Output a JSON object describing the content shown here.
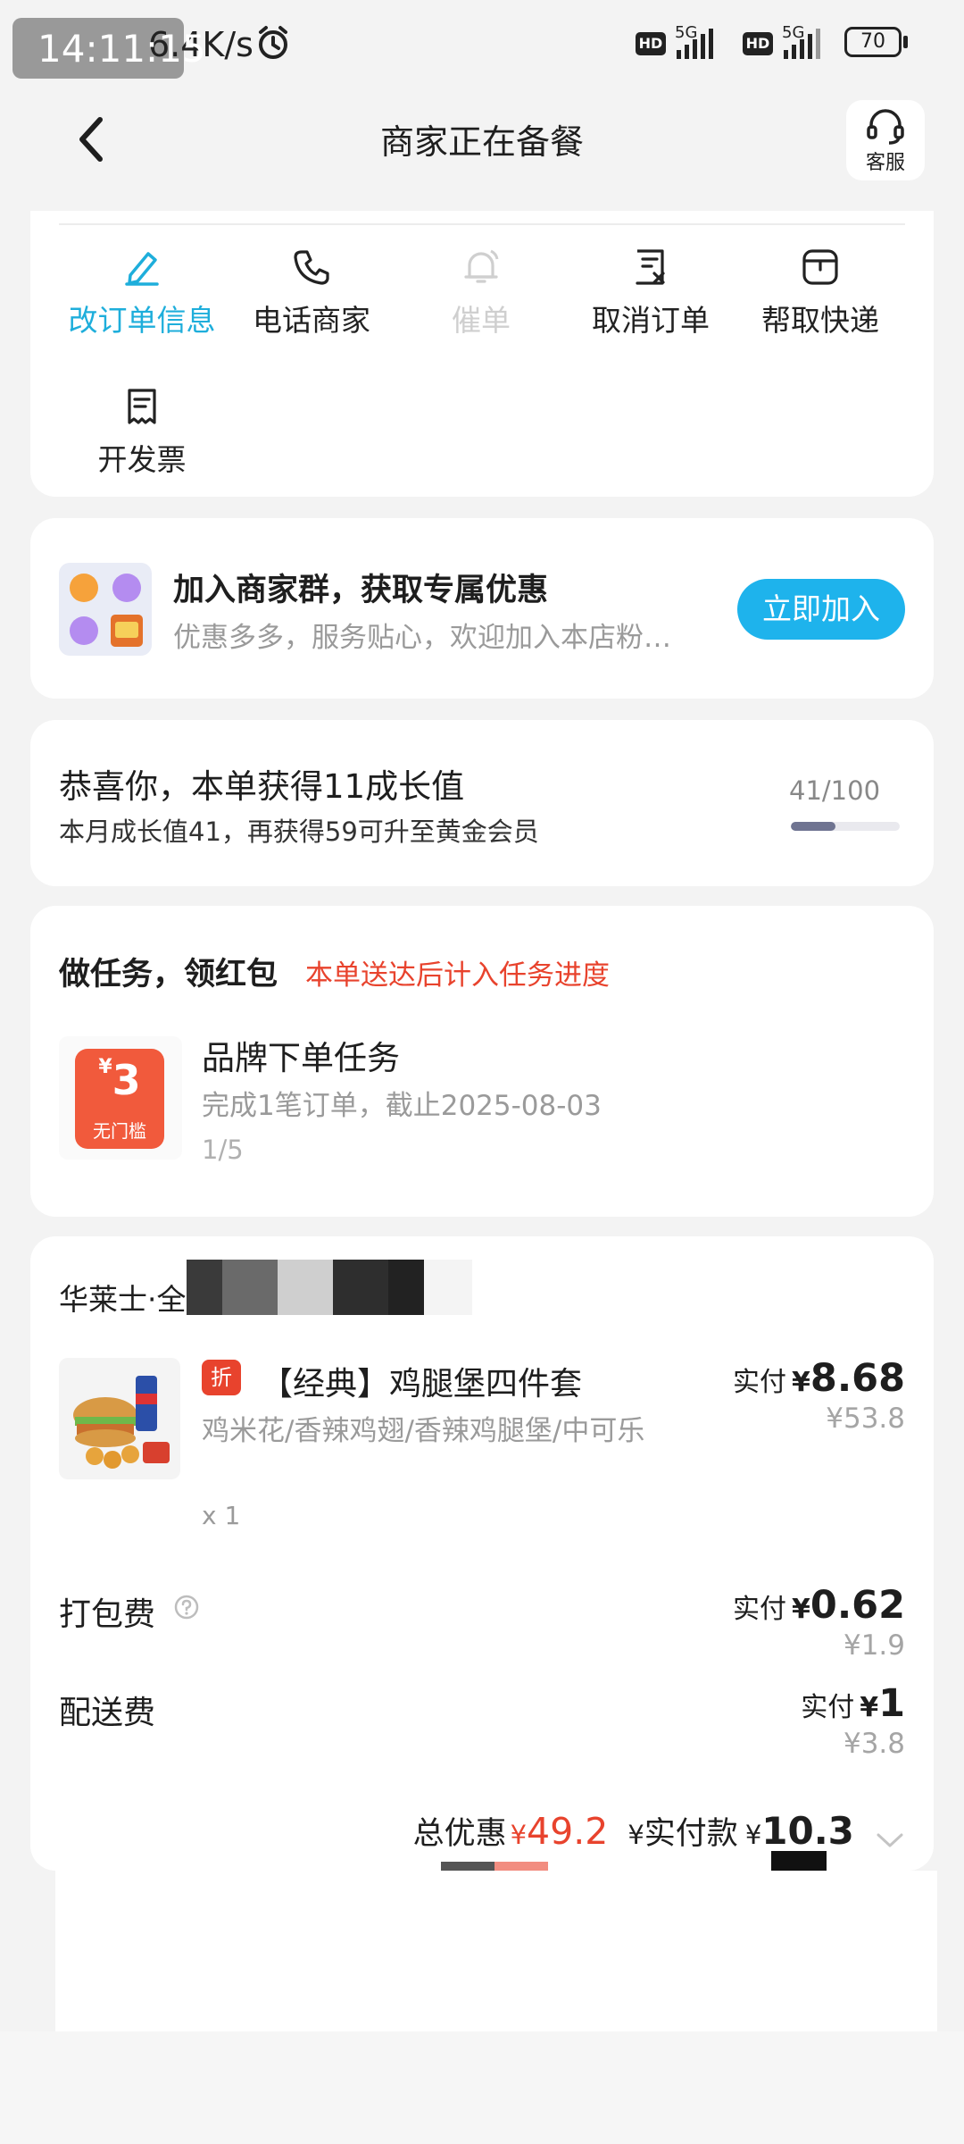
{
  "status_bar": {
    "time": "14:11:15",
    "speed": "6.4K/s",
    "sim1_network": "5G",
    "sim2_network": "5G",
    "hd_label": "HD",
    "battery": "70",
    "icons": [
      "alarm-icon",
      "signal-icon",
      "battery-icon"
    ]
  },
  "header": {
    "title": "商家正在备餐",
    "service_label": "客服",
    "icons": [
      "back-icon",
      "headset-icon"
    ]
  },
  "actions": [
    {
      "label": "改订单信息",
      "icon": "edit-icon",
      "color": "#1eaedb",
      "enabled": true
    },
    {
      "label": "电话商家",
      "icon": "phone-icon",
      "color": "#222222",
      "enabled": true
    },
    {
      "label": "催单",
      "icon": "bell-icon",
      "color": "#cfcfcf",
      "enabled": false
    },
    {
      "label": "取消订单",
      "icon": "cancel-doc-icon",
      "color": "#222222",
      "enabled": true
    },
    {
      "label": "帮取快递",
      "icon": "parcel-icon",
      "color": "#222222",
      "enabled": true
    },
    {
      "label": "开发票",
      "icon": "invoice-icon",
      "color": "#222222",
      "enabled": true
    }
  ],
  "merchant_group": {
    "title": "加入商家群，获取专属优惠",
    "subtitle": "优惠多多，服务贴心，欢迎加入本店粉…",
    "button": "立即加入",
    "accent": "#1eb3ec"
  },
  "growth": {
    "title": "恭喜你，本单获得11成长值",
    "subtitle": "本月成长值41，再获得59可升至黄金会员",
    "progress_text": "41/100",
    "progress_fraction": 0.41
  },
  "task": {
    "title": "做任务，领红包",
    "note": "本单送达后计入任务进度",
    "coupon_symbol": "¥",
    "coupon_amount": "3",
    "coupon_label": "无门槛",
    "name": "品牌下单任务",
    "description": "完成1笔订单，截止2025-08-03",
    "progress": "1/5"
  },
  "order": {
    "shop_name": "华莱士·全鸡",
    "item": {
      "tag": "折",
      "name": "【经典】鸡腿堡四件套",
      "description": "鸡米花/香辣鸡翅/香辣鸡腿堡/中可乐",
      "quantity": "x 1",
      "pay_label": "实付",
      "currency": "¥",
      "paid": "8.68",
      "original": "¥53.8"
    },
    "packaging": {
      "label": "打包费",
      "pay_label": "实付",
      "currency": "¥",
      "paid": "0.62",
      "original": "¥1.9"
    },
    "delivery": {
      "label": "配送费",
      "pay_label": "实付",
      "currency": "¥",
      "paid": "1",
      "original": "¥3.8"
    },
    "summary": {
      "discount_label": "总优惠",
      "currency": "¥",
      "discount": "49.2",
      "paid_label": "实付款",
      "paid": "10.3"
    }
  },
  "colors": {
    "accent_blue": "#1eaedb",
    "discount_red": "#e8432d",
    "background": "#f3f3f3"
  }
}
